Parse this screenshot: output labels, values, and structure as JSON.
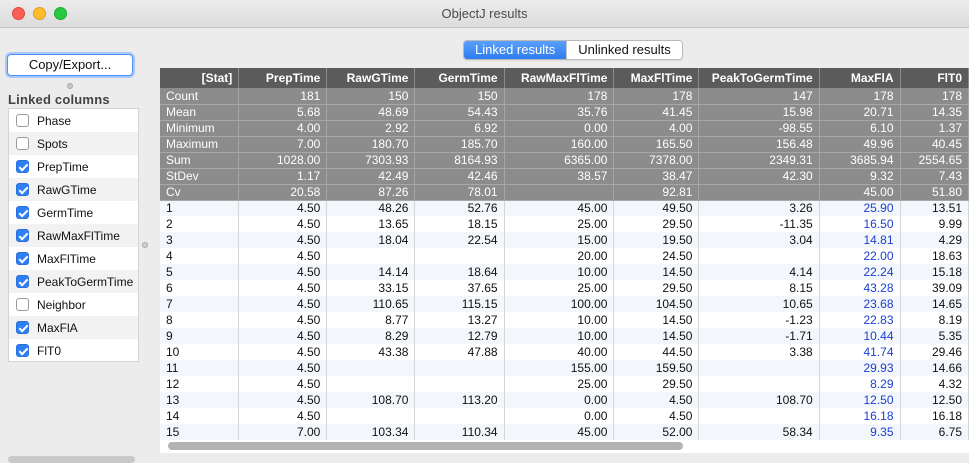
{
  "window": {
    "title": "ObjectJ results"
  },
  "left": {
    "copy_button": "Copy/Export...",
    "linked_columns_title": "Linked columns",
    "columns": [
      {
        "label": "Phase",
        "checked": false
      },
      {
        "label": "Spots",
        "checked": false
      },
      {
        "label": "PrepTime",
        "checked": true
      },
      {
        "label": "RawGTime",
        "checked": true
      },
      {
        "label": "GermTime",
        "checked": true
      },
      {
        "label": "RawMaxFlTime",
        "checked": true
      },
      {
        "label": "MaxFlTime",
        "checked": true
      },
      {
        "label": "PeakToGermTime",
        "checked": true
      },
      {
        "label": "Neighbor",
        "checked": false
      },
      {
        "label": "MaxFlA",
        "checked": true
      },
      {
        "label": "FlT0",
        "checked": true
      }
    ]
  },
  "tabs": {
    "linked": "Linked results",
    "unlinked": "Unlinked results",
    "active": "linked"
  },
  "table": {
    "headers": [
      "[Stat]",
      "PrepTime",
      "RawGTime",
      "GermTime",
      "RawMaxFlTime",
      "MaxFlTime",
      "PeakToGermTime",
      "MaxFlA",
      "FlT0"
    ],
    "stat_rows": [
      [
        "Count",
        "181",
        "150",
        "150",
        "178",
        "178",
        "147",
        "178",
        "178"
      ],
      [
        "Mean",
        "5.68",
        "48.69",
        "54.43",
        "35.76",
        "41.45",
        "15.98",
        "20.71",
        "14.35"
      ],
      [
        "Minimum",
        "4.00",
        "2.92",
        "6.92",
        "0.00",
        "4.00",
        "-98.55",
        "6.10",
        "1.37"
      ],
      [
        "Maximum",
        "7.00",
        "180.70",
        "185.70",
        "160.00",
        "165.50",
        "156.48",
        "49.96",
        "40.45"
      ],
      [
        "Sum",
        "1028.00",
        "7303.93",
        "8164.93",
        "6365.00",
        "7378.00",
        "2349.31",
        "3685.94",
        "2554.65"
      ],
      [
        "StDev",
        "1.17",
        "42.49",
        "42.46",
        "38.57",
        "38.47",
        "42.30",
        "9.32",
        "7.43"
      ],
      [
        "Cv",
        "20.58",
        "87.26",
        "78.01",
        "",
        "92.81",
        "",
        "45.00",
        "51.80"
      ]
    ],
    "data_rows": [
      [
        "1",
        "4.50",
        "48.26",
        "52.76",
        "45.00",
        "49.50",
        "3.26",
        "25.90",
        "13.51"
      ],
      [
        "2",
        "4.50",
        "13.65",
        "18.15",
        "25.00",
        "29.50",
        "-11.35",
        "16.50",
        "9.99"
      ],
      [
        "3",
        "4.50",
        "18.04",
        "22.54",
        "15.00",
        "19.50",
        "3.04",
        "14.81",
        "4.29"
      ],
      [
        "4",
        "4.50",
        "",
        "",
        "20.00",
        "24.50",
        "",
        "22.00",
        "18.63"
      ],
      [
        "5",
        "4.50",
        "14.14",
        "18.64",
        "10.00",
        "14.50",
        "4.14",
        "22.24",
        "15.18"
      ],
      [
        "6",
        "4.50",
        "33.15",
        "37.65",
        "25.00",
        "29.50",
        "8.15",
        "43.28",
        "39.09"
      ],
      [
        "7",
        "4.50",
        "110.65",
        "115.15",
        "100.00",
        "104.50",
        "10.65",
        "23.68",
        "14.65"
      ],
      [
        "8",
        "4.50",
        "8.77",
        "13.27",
        "10.00",
        "14.50",
        "-1.23",
        "22.83",
        "8.19"
      ],
      [
        "9",
        "4.50",
        "8.29",
        "12.79",
        "10.00",
        "14.50",
        "-1.71",
        "10.44",
        "5.35"
      ],
      [
        "10",
        "4.50",
        "43.38",
        "47.88",
        "40.00",
        "44.50",
        "3.38",
        "41.74",
        "29.46"
      ],
      [
        "11",
        "4.50",
        "",
        "",
        "155.00",
        "159.50",
        "",
        "29.93",
        "14.66"
      ],
      [
        "12",
        "4.50",
        "",
        "",
        "25.00",
        "29.50",
        "",
        "8.29",
        "4.32"
      ],
      [
        "13",
        "4.50",
        "108.70",
        "113.20",
        "0.00",
        "4.50",
        "108.70",
        "12.50",
        "12.50"
      ],
      [
        "14",
        "4.50",
        "",
        "",
        "0.00",
        "4.50",
        "",
        "16.18",
        "16.18"
      ],
      [
        "15",
        "7.00",
        "103.34",
        "110.34",
        "45.00",
        "52.00",
        "58.34",
        "9.35",
        "6.75"
      ]
    ],
    "blue_column_index": 7
  },
  "colors": {
    "accent": "#2f7ff5",
    "header_bg": "#5b5b5b",
    "stat_bg": "#8c8c8c",
    "link_blue": "#1a3fd1"
  }
}
